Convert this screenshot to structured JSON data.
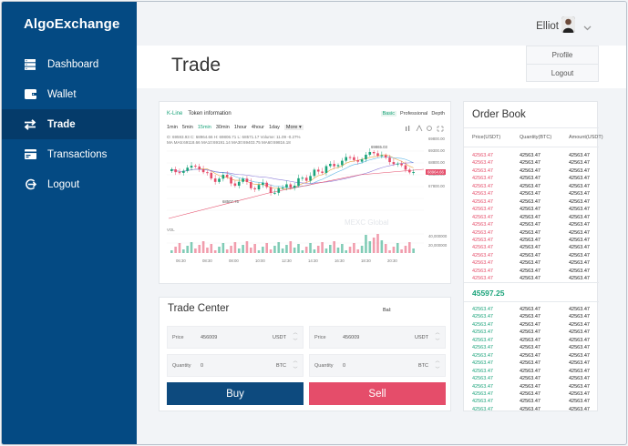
{
  "brand": "AlgoExchange",
  "sidebar": {
    "items": [
      {
        "label": "Dashboard",
        "icon": "server-icon"
      },
      {
        "label": "Wallet",
        "icon": "wallet-icon"
      },
      {
        "label": "Trade",
        "icon": "swap-arrows-icon",
        "active": true
      },
      {
        "label": "Transactions",
        "icon": "card-icon"
      },
      {
        "label": "Logout",
        "icon": "logout-icon"
      }
    ]
  },
  "header": {
    "username": "Elliot",
    "menu": [
      "Profile",
      "Logout"
    ]
  },
  "page_title": "Trade",
  "chart": {
    "tab_kline": "K-Line",
    "tab_token": "Token information",
    "views": [
      "Basic",
      "Professional",
      "Depth"
    ],
    "intervals": [
      "1min",
      "5min",
      "15min",
      "30min",
      "1hour",
      "4hour",
      "1day"
    ],
    "active_interval": "15min",
    "more_label": "More ▾",
    "ohlc": "O: 69593.93   C: 68964.66   H: 69806.71   L: 68571.17   Volume: 11.09   -0.27%",
    "ma": "MA   MA5:69118.66   MA10:69191.14   MA30:69403.75   MA60:69816.18",
    "watermark": "MEXC Global",
    "price_labels": [
      "69800.00",
      "69300.00",
      "68964.66",
      "68800.00",
      "68300.00",
      "67800.00"
    ],
    "high_mark": "69865.03",
    "low_mark": "68507.75",
    "vol_label": "VOL",
    "vol_scale": [
      "40,000000",
      "20,000000"
    ],
    "time_labels": [
      "06:30",
      "08:30",
      "08:00",
      "10:00",
      "12:30",
      "14:30",
      "16:30",
      "18:30",
      "20:30"
    ],
    "colors": {
      "up": "#1aa37a",
      "down": "#e54d6a",
      "ma5": "#e8a23a",
      "ma10": "#5ab4e5",
      "ma30": "#8b7cd8"
    }
  },
  "trade": {
    "title": "Trade Center",
    "bal_label": "Bal:",
    "buy": {
      "price_label": "Price",
      "price_value": "456009",
      "price_unit": "USDT",
      "qty_label": "Quantity",
      "qty_value": "0",
      "qty_unit": "BTC",
      "button": "Buy"
    },
    "sell": {
      "price_label": "Price",
      "price_value": "456009",
      "price_unit": "USDT",
      "qty_label": "Quantity",
      "qty_value": "0",
      "qty_unit": "BTC",
      "button": "Sell"
    }
  },
  "order_book": {
    "title": "Order Book",
    "columns": [
      "Price(USDT)",
      "Quantity(BTC)",
      "Amount(USDT)"
    ],
    "asks": [
      [
        "42563.47",
        "42563.47",
        "42563.47"
      ],
      [
        "42563.47",
        "42563.47",
        "42563.47"
      ],
      [
        "42563.47",
        "42563.47",
        "42563.47"
      ],
      [
        "42563.47",
        "42563.47",
        "42563.47"
      ],
      [
        "42563.47",
        "42563.47",
        "42563.47"
      ],
      [
        "42563.47",
        "42563.47",
        "42563.47"
      ],
      [
        "42563.47",
        "42563.47",
        "42563.47"
      ],
      [
        "42563.47",
        "42563.47",
        "42563.47"
      ],
      [
        "42563.47",
        "42563.47",
        "42563.47"
      ],
      [
        "42563.47",
        "42563.47",
        "42563.47"
      ],
      [
        "42563.47",
        "42563.47",
        "42563.47"
      ],
      [
        "42563.47",
        "42563.47",
        "42563.47"
      ],
      [
        "42563.47",
        "42563.47",
        "42563.47"
      ],
      [
        "42563.47",
        "42563.47",
        "42563.47"
      ],
      [
        "42563.47",
        "42563.47",
        "42563.47"
      ],
      [
        "42563.47",
        "42563.47",
        "42563.47"
      ],
      [
        "42563.47",
        "42563.47",
        "42563.47"
      ]
    ],
    "last_price": "45597.25",
    "bids": [
      [
        "42563.47",
        "42563.47",
        "42563.47"
      ],
      [
        "42563.47",
        "42563.47",
        "42563.47"
      ],
      [
        "42563.47",
        "42563.47",
        "42563.47"
      ],
      [
        "42563.47",
        "42563.47",
        "42563.47"
      ],
      [
        "42563.47",
        "42563.47",
        "42563.47"
      ],
      [
        "42563.47",
        "42563.47",
        "42563.47"
      ],
      [
        "42563.47",
        "42563.47",
        "42563.47"
      ],
      [
        "42563.47",
        "42563.47",
        "42563.47"
      ],
      [
        "42563.47",
        "42563.47",
        "42563.47"
      ],
      [
        "42563.47",
        "42563.47",
        "42563.47"
      ],
      [
        "42563.47",
        "42563.47",
        "42563.47"
      ],
      [
        "42563.47",
        "42563.47",
        "42563.47"
      ],
      [
        "42563.47",
        "42563.47",
        "42563.47"
      ],
      [
        "42563.47",
        "42563.47",
        "42563.47"
      ]
    ],
    "colors": {
      "ask": "#e54d6a",
      "bid": "#1aa37a"
    }
  }
}
